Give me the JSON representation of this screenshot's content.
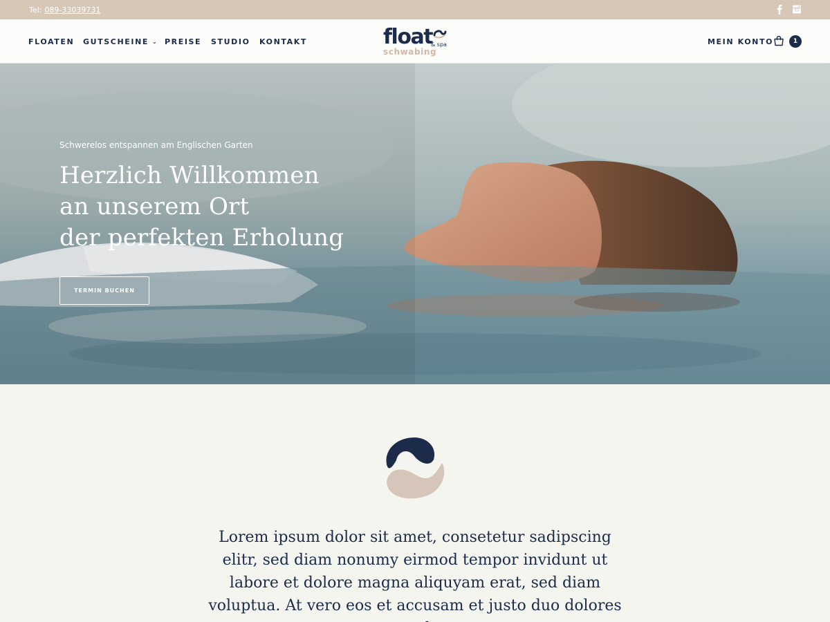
{
  "topbar": {
    "tel_label": "Tel:",
    "tel_number": "089-33039731",
    "social_icons": [
      "facebook-icon",
      "instagram-icon"
    ]
  },
  "nav": {
    "items": [
      {
        "label": "FLOATEN",
        "has_dropdown": false
      },
      {
        "label": "GUTSCHEINE",
        "has_dropdown": true
      },
      {
        "label": "PREISE",
        "has_dropdown": false
      },
      {
        "label": "STUDIO",
        "has_dropdown": false
      },
      {
        "label": "KONTAKT",
        "has_dropdown": false
      }
    ],
    "logo": {
      "word": "float",
      "suffix": "& spa",
      "subtitle": "schwabing"
    },
    "account_label": "MEIN KONTO",
    "cart_count": "1",
    "cart_icon": "shopping-bag-icon"
  },
  "hero": {
    "tagline": "Schwerelos entspannen am Englischen Garten",
    "title_lines": [
      "Herzlich Willkommen",
      "an unserem Ort",
      "der perfekten Erholung"
    ],
    "button_label": "TERMIN BUCHEN"
  },
  "content": {
    "emblem_icon": "wave-emblem-icon",
    "text": "Lorem ipsum dolor sit amet, consetetur sadipscing elitr, sed diam nonumy eirmod tempor invidunt ut labore et dolore magna aliquyam erat, sed diam voluptua. At vero eos et accusam et justo duo dolores et ea rebum."
  },
  "colors": {
    "navy": "#1c2b4a",
    "sand": "#d7c7b7",
    "background": "#f5f5f0"
  }
}
